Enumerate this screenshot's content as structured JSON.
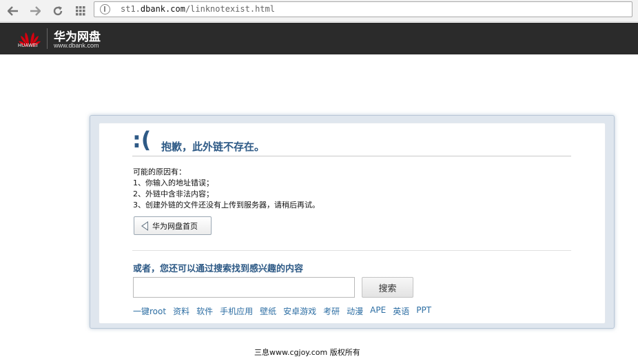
{
  "browser": {
    "url_prefix": "st1.",
    "url_host": "dbank.com",
    "url_path": "/linknotexist.html"
  },
  "header": {
    "logo_text": "HUAWEI",
    "brand_title": "华为网盘",
    "brand_url": "www.dbank.com"
  },
  "error": {
    "face": ":(",
    "title": "抱歉，此外链不存在。",
    "reasons_heading": "可能的原因有：",
    "reasons": [
      "1、你输入的地址错误；",
      "2、外链中含非法内容；",
      "3、创建外链的文件还没有上传到服务器，请稍后再试。"
    ],
    "home_button": "华为网盘首页"
  },
  "search": {
    "title": "或者，您还可以通过搜索找到感兴趣的内容",
    "input_value": "",
    "button": "搜索",
    "tags": [
      "一键root",
      "资料",
      "软件",
      "手机应用",
      "壁纸",
      "安卓游戏",
      "考研",
      "动漫",
      "APE",
      "英语",
      "PPT"
    ]
  },
  "watermark": "三息www.cgjoy.com 版权所有",
  "colors": {
    "header_bg": "#2b2b2b",
    "accent_blue": "#2e5a86",
    "link_blue": "#2d6ea3",
    "huawei_red": "#d7000f"
  }
}
